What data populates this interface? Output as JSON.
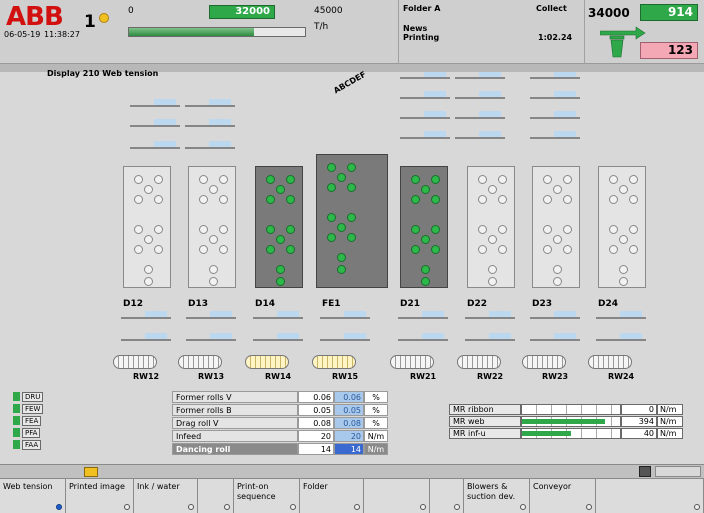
{
  "header": {
    "logo": "ABB",
    "press_number": "1",
    "date": "06-05-19",
    "time": "11:38:27",
    "speed_min": "0",
    "speed_current": "32000",
    "speed_max": "45000",
    "speed_unit": "T/h",
    "speed_fraction": 0.71,
    "folder": "Folder A",
    "product_line1": "News",
    "product_line2": "Printing",
    "collect": "Collect",
    "elapsed": "1:02.24",
    "count_target": "34000",
    "count_good": "914",
    "count_waste": "123"
  },
  "page_title": "Display 210 Web tension",
  "ribbon_letters": "ABCDEF",
  "units": [
    {
      "label": "D12",
      "active": false
    },
    {
      "label": "D13",
      "active": false
    },
    {
      "label": "D14",
      "active": true
    },
    {
      "label": "FE1",
      "active": true
    },
    {
      "label": "D21",
      "active": true
    },
    {
      "label": "D22",
      "active": false
    },
    {
      "label": "D23",
      "active": false
    },
    {
      "label": "D24",
      "active": false
    }
  ],
  "reels": [
    "RW12",
    "RW13",
    "RW14",
    "RW15",
    "RW21",
    "RW22",
    "RW23",
    "RW24"
  ],
  "status_list": [
    "DRU",
    "FEW",
    "FEA",
    "PFA",
    "FAA"
  ],
  "tension_table": [
    {
      "name": "Former rolls V",
      "v1": "0.06",
      "v2": "0.06",
      "unit": "%"
    },
    {
      "name": "Former rolls B",
      "v1": "0.05",
      "v2": "0.05",
      "unit": "%"
    },
    {
      "name": "Drag roll V",
      "v1": "0.08",
      "v2": "0.08",
      "unit": "%"
    },
    {
      "name": "Infeed",
      "v1": "20",
      "v2": "20",
      "unit": "N/m"
    },
    {
      "name": "Dancing roll",
      "v1": "14",
      "v2": "14",
      "unit": "N/m"
    }
  ],
  "mr_table": [
    {
      "name": "MR ribbon",
      "value": "0",
      "unit": "N/m",
      "fraction": 0.0
    },
    {
      "name": "MR web",
      "value": "394",
      "unit": "N/m",
      "fraction": 0.85
    },
    {
      "name": "MR inf-u",
      "value": "40",
      "unit": "N/m",
      "fraction": 0.5
    }
  ],
  "footer": [
    {
      "label": "Web tension",
      "active": true
    },
    {
      "label": "Printed image",
      "active": false
    },
    {
      "label": "Ink / water",
      "active": false
    },
    {
      "label": "",
      "active": false
    },
    {
      "label": "Print-on sequence",
      "active": false
    },
    {
      "label": "Folder",
      "active": false
    },
    {
      "label": "",
      "active": false
    },
    {
      "label": "",
      "active": false
    },
    {
      "label": "Blowers & suction dev.",
      "active": false
    },
    {
      "label": "Conveyor",
      "active": false
    },
    {
      "label": "",
      "active": false
    }
  ]
}
